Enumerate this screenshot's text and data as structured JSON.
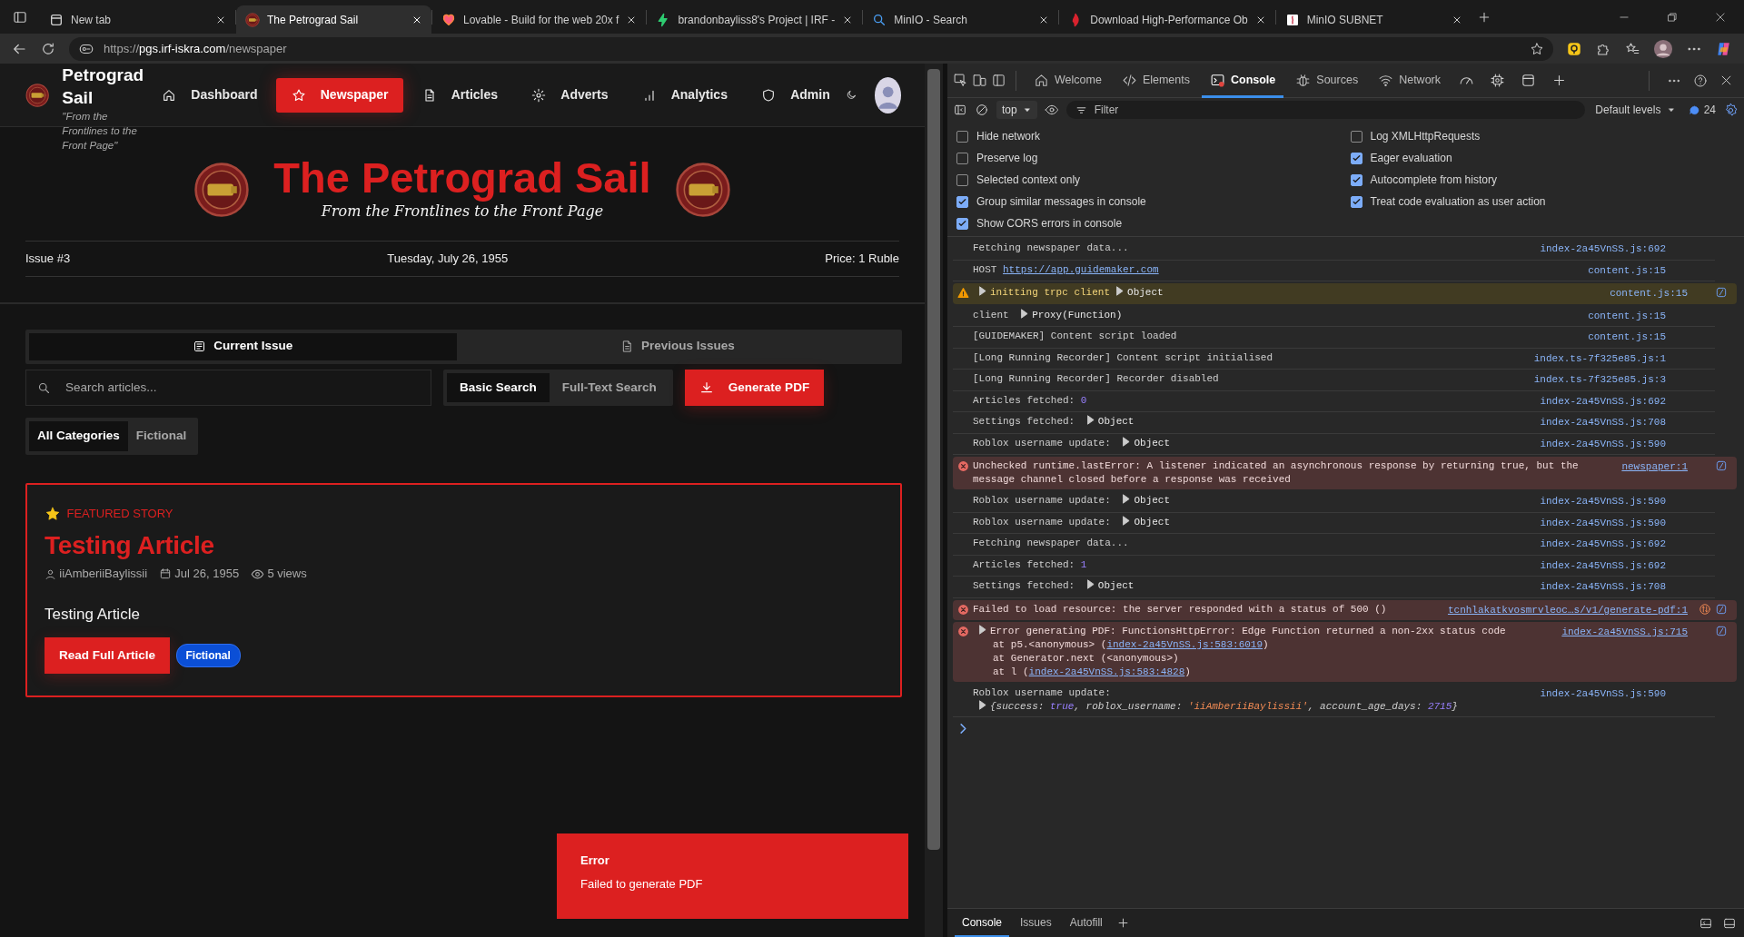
{
  "browser": {
    "tabs": [
      {
        "title": "New tab",
        "selected": false
      },
      {
        "title": "The Petrograd Sail",
        "selected": true
      },
      {
        "title": "Lovable - Build for the web 20x f",
        "selected": false
      },
      {
        "title": "brandonbayliss8's Project | IRF -",
        "selected": false
      },
      {
        "title": "MinIO - Search",
        "selected": false
      },
      {
        "title": "Download High-Performance Ob",
        "selected": false
      },
      {
        "title": "MinIO SUBNET",
        "selected": false
      }
    ],
    "address": {
      "scheme": "https://",
      "host": "pgs.irf-iskra.com",
      "path": "/newspaper"
    }
  },
  "site": {
    "brand": "Petrograd Sail",
    "tagline": "\"From the Frontlines to the Front Page\"",
    "nav": [
      {
        "label": "Dashboard",
        "selected": false
      },
      {
        "label": "Newspaper",
        "selected": true
      },
      {
        "label": "Articles",
        "selected": false
      },
      {
        "label": "Adverts",
        "selected": false
      },
      {
        "label": "Analytics",
        "selected": false
      },
      {
        "label": "Admin",
        "selected": false
      }
    ],
    "masthead": {
      "title": "The Petrograd Sail",
      "subtitle": "From the Frontlines to the Front Page",
      "issue": "Issue #3",
      "date": "Tuesday, July 26, 1955",
      "price": "Price: 1 Ruble"
    },
    "issue_tabs": [
      {
        "label": "Current Issue",
        "selected": true
      },
      {
        "label": "Previous Issues",
        "selected": false
      }
    ],
    "search": {
      "placeholder": "Search articles..."
    },
    "search_modes": [
      {
        "label": "Basic Search",
        "selected": true
      },
      {
        "label": "Full-Text Search",
        "selected": false
      }
    ],
    "generate_button": "Generate PDF",
    "categories": [
      {
        "label": "All Categories",
        "selected": true
      },
      {
        "label": "Fictional",
        "selected": false
      }
    ],
    "featured": {
      "label": "FEATURED STORY",
      "title": "Testing Article",
      "author": "iiAmberiiBaylissii",
      "date": "Jul 26, 1955",
      "views": "5 views",
      "excerpt": "Testing Article",
      "button": "Read Full Article",
      "tag": "Fictional"
    },
    "toast": {
      "title": "Error",
      "message": "Failed to generate PDF"
    }
  },
  "devtools": {
    "tabs": [
      {
        "label": "Welcome",
        "selected": false
      },
      {
        "label": "Elements",
        "selected": false
      },
      {
        "label": "Console",
        "selected": true
      },
      {
        "label": "Sources",
        "selected": false
      },
      {
        "label": "Network",
        "selected": false
      }
    ],
    "toolbar": {
      "context": "top",
      "filter_placeholder": "Filter",
      "levels": "Default levels",
      "message_count": "24"
    },
    "settings": {
      "left": [
        {
          "label": "Hide network",
          "checked": false
        },
        {
          "label": "Preserve log",
          "checked": false
        },
        {
          "label": "Selected context only",
          "checked": false
        },
        {
          "label": "Group similar messages in console",
          "checked": true
        },
        {
          "label": "Show CORS errors in console",
          "checked": true
        }
      ],
      "right": [
        {
          "label": "Log XMLHttpRequests",
          "checked": false
        },
        {
          "label": "Eager evaluation",
          "checked": true
        },
        {
          "label": "Autocomplete from history",
          "checked": true
        },
        {
          "label": "Treat code evaluation as user action",
          "checked": true
        }
      ]
    },
    "logs": [
      {
        "kind": "info",
        "lines": [
          {
            "parts": [
              {
                "kind": "text",
                "text": "Fetching newspaper data..."
              }
            ]
          }
        ],
        "source": "index-2a45VnSS.js:692"
      },
      {
        "kind": "info",
        "lines": [
          {
            "parts": [
              {
                "kind": "text",
                "text": "HOST "
              },
              {
                "kind": "link",
                "text": "https://app.guidemaker.com"
              }
            ]
          }
        ],
        "source": "content.js:15"
      },
      {
        "kind": "warning",
        "explain": true,
        "lines": [
          {
            "parts": [
              {
                "kind": "toggle",
                "expanded": false
              },
              {
                "kind": "text",
                "text": "initting trpc client"
              },
              {
                "kind": "toggle",
                "expanded": false
              },
              {
                "kind": "object",
                "text": "Object"
              }
            ]
          }
        ],
        "source": "content.js:15"
      },
      {
        "kind": "info",
        "lines": [
          {
            "parts": [
              {
                "kind": "text",
                "text": "client "
              },
              {
                "kind": "toggle",
                "expanded": false
              },
              {
                "kind": "object",
                "text": "Proxy(Function)"
              }
            ]
          }
        ],
        "source": "content.js:15"
      },
      {
        "kind": "info",
        "lines": [
          {
            "parts": [
              {
                "kind": "text",
                "text": "[GUIDEMAKER] Content script loaded"
              }
            ]
          }
        ],
        "source": "content.js:15"
      },
      {
        "kind": "info",
        "lines": [
          {
            "parts": [
              {
                "kind": "text",
                "text": "[Long Running Recorder] Content script initialised"
              }
            ]
          }
        ],
        "source": "index.ts-7f325e85.js:1"
      },
      {
        "kind": "info",
        "lines": [
          {
            "parts": [
              {
                "kind": "text",
                "text": "[Long Running Recorder] Recorder disabled"
              }
            ]
          }
        ],
        "source": "index.ts-7f325e85.js:3"
      },
      {
        "kind": "info",
        "lines": [
          {
            "parts": [
              {
                "kind": "text",
                "text": "Articles fetched: "
              },
              {
                "kind": "number",
                "text": "0"
              }
            ]
          }
        ],
        "source": "index-2a45VnSS.js:692"
      },
      {
        "kind": "info",
        "lines": [
          {
            "parts": [
              {
                "kind": "text",
                "text": "Settings fetched: "
              },
              {
                "kind": "toggle",
                "expanded": false
              },
              {
                "kind": "object",
                "text": "Object"
              }
            ]
          }
        ],
        "source": "index-2a45VnSS.js:708"
      },
      {
        "kind": "info",
        "lines": [
          {
            "parts": [
              {
                "kind": "text",
                "text": "Roblox username update: "
              },
              {
                "kind": "toggle",
                "expanded": false
              },
              {
                "kind": "object",
                "text": "Object"
              }
            ]
          }
        ],
        "source": "index-2a45VnSS.js:590"
      },
      {
        "kind": "error",
        "explain": true,
        "lines": [
          {
            "parts": [
              {
                "kind": "text",
                "text": "Unchecked runtime.lastError: A listener indicated an asynchronous response by returning true, but the message channel closed before a response was received"
              }
            ]
          }
        ],
        "source": "newspaper:1"
      },
      {
        "kind": "info",
        "lines": [
          {
            "parts": [
              {
                "kind": "text",
                "text": "Roblox username update: "
              },
              {
                "kind": "toggle",
                "expanded": false
              },
              {
                "kind": "object",
                "text": "Object"
              }
            ]
          }
        ],
        "source": "index-2a45VnSS.js:590"
      },
      {
        "kind": "info",
        "lines": [
          {
            "parts": [
              {
                "kind": "text",
                "text": "Roblox username update: "
              },
              {
                "kind": "toggle",
                "expanded": false
              },
              {
                "kind": "object",
                "text": "Object"
              }
            ]
          }
        ],
        "source": "index-2a45VnSS.js:590"
      },
      {
        "kind": "info",
        "lines": [
          {
            "parts": [
              {
                "kind": "text",
                "text": "Fetching newspaper data..."
              }
            ]
          }
        ],
        "source": "index-2a45VnSS.js:692"
      },
      {
        "kind": "info",
        "lines": [
          {
            "parts": [
              {
                "kind": "text",
                "text": "Articles fetched: "
              },
              {
                "kind": "number",
                "text": "1"
              }
            ]
          }
        ],
        "source": "index-2a45VnSS.js:692"
      },
      {
        "kind": "info",
        "lines": [
          {
            "parts": [
              {
                "kind": "text",
                "text": "Settings fetched: "
              },
              {
                "kind": "toggle",
                "expanded": false
              },
              {
                "kind": "object",
                "text": "Object"
              }
            ]
          }
        ],
        "source": "index-2a45VnSS.js:708"
      },
      {
        "kind": "error",
        "network": true,
        "explain": true,
        "lines": [
          {
            "parts": [
              {
                "kind": "text",
                "text": "Failed to load resource: the server responded with a status of 500 ()"
              }
            ]
          }
        ],
        "source": "tcnhlakatkvosmrvleoc…s/v1/generate-pdf:1"
      },
      {
        "kind": "error",
        "explain": true,
        "lines": [
          {
            "parts": [
              {
                "kind": "toggle",
                "expanded": false
              },
              {
                "kind": "text",
                "text": "Error generating PDF: FunctionsHttpError: Edge Function returned a non-2xx status code"
              }
            ]
          },
          {
            "stack": true,
            "parts": [
              {
                "kind": "text",
                "text": "at p5.<anonymous> ("
              },
              {
                "kind": "link",
                "text": "index-2a45VnSS.js:583:6019"
              },
              {
                "kind": "text",
                "text": ")"
              }
            ]
          },
          {
            "stack": true,
            "parts": [
              {
                "kind": "text",
                "text": "at Generator.next (<anonymous>)"
              }
            ]
          },
          {
            "stack": true,
            "parts": [
              {
                "kind": "text",
                "text": "at l ("
              },
              {
                "kind": "link",
                "text": "index-2a45VnSS.js:583:4828"
              },
              {
                "kind": "text",
                "text": ")"
              }
            ]
          }
        ],
        "source": "index-2a45VnSS.js:715"
      },
      {
        "kind": "info",
        "lines": [
          {
            "parts": [
              {
                "kind": "text",
                "text": "Roblox username update:"
              }
            ]
          },
          {
            "italic": true,
            "parts": [
              {
                "kind": "toggle",
                "expanded": false
              },
              {
                "kind": "text",
                "text": "{success: "
              },
              {
                "kind": "boolean",
                "text": "true"
              },
              {
                "kind": "text",
                "text": ", roblox_username: "
              },
              {
                "kind": "string",
                "text": "'iiAmberiiBaylissii'"
              },
              {
                "kind": "text",
                "text": ", account_age_days: "
              },
              {
                "kind": "number",
                "text": "2715"
              },
              {
                "kind": "text",
                "text": "}"
              }
            ]
          }
        ],
        "source": "index-2a45VnSS.js:590"
      }
    ],
    "drawer_tabs": [
      {
        "label": "Console",
        "selected": true
      },
      {
        "label": "Issues",
        "selected": false
      },
      {
        "label": "Autofill",
        "selected": false
      }
    ]
  }
}
